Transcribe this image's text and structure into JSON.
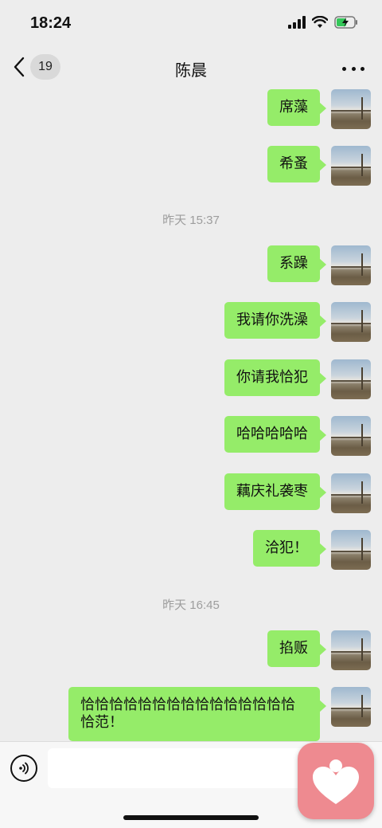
{
  "status_bar": {
    "time": "18:24"
  },
  "nav": {
    "badge_count": "19",
    "title": "陈晨"
  },
  "messages": [
    {
      "text": "席藻"
    },
    {
      "text": "希蚤"
    },
    {
      "text": "系躁"
    },
    {
      "text": "我请你洗澡"
    },
    {
      "text": "你请我恰犯"
    },
    {
      "text": "哈哈哈哈哈"
    },
    {
      "text": "藕庆礼袭枣"
    },
    {
      "text": "洽犯！"
    },
    {
      "text": "掐贩"
    },
    {
      "text": "恰恰恰恰恰恰恰恰恰恰恰恰恰恰恰恰范！"
    }
  ],
  "dividers": [
    {
      "text": "昨天 15:37"
    },
    {
      "text": "昨天 16:45"
    }
  ],
  "input": {
    "value": ""
  },
  "colors": {
    "bubble": "#95ec69",
    "background": "#ededed",
    "floating_app": "#ee8a90"
  },
  "icons": {
    "back": "chevron-left-icon",
    "more": "more-dots-icon",
    "voice": "voice-icon",
    "app": "heart-person-icon"
  }
}
